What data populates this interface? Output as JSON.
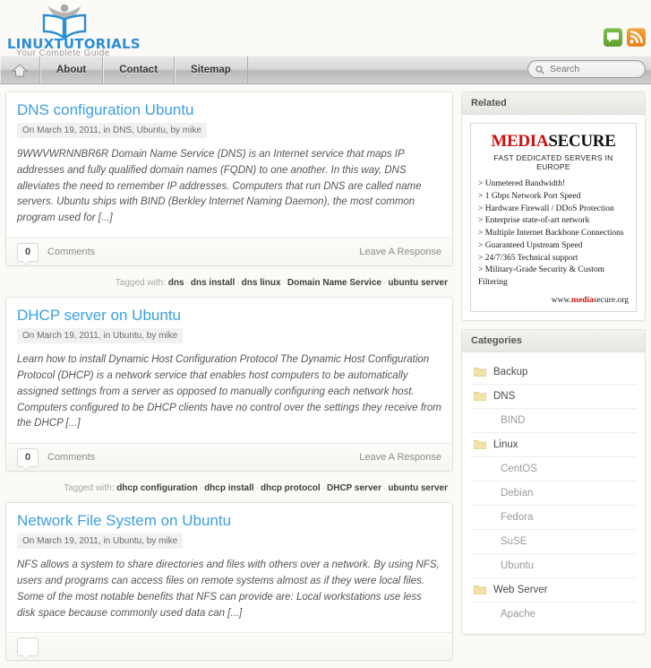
{
  "site": {
    "logo_word_1": "LINUX",
    "logo_word_2": "TUTORIALS",
    "logo_sub": "Your  Complete  Guide"
  },
  "social": [
    {
      "name": "comments-icon",
      "label": "Comments"
    },
    {
      "name": "rss-icon",
      "label": "RSS"
    }
  ],
  "nav": {
    "home_label": "Home",
    "items": [
      {
        "label": "About"
      },
      {
        "label": "Contact"
      },
      {
        "label": "Sitemap"
      }
    ]
  },
  "search": {
    "placeholder": "Search",
    "value": ""
  },
  "posts": [
    {
      "title": "DNS configuration Ubuntu",
      "meta": "On March 19, 2011, in DNS, Ubuntu, by mike",
      "excerpt": "9WWVWRNNBR6R Domain Name Service (DNS) is an Internet service that maps IP addresses and fully qualified domain names (FQDN) to one another. In this way, DNS alleviates the need to remember IP addresses. Computers that run DNS are called name servers. Ubuntu ships with BIND (Berkley Internet Naming Daemon), the most common program used for [...]",
      "comment_count": "0",
      "comments_label": "Comments",
      "respond_label": "Leave A Response",
      "tagged_label": "Tagged with:",
      "tags": [
        "dns",
        "dns install",
        "dns linux",
        "Domain Name Service",
        "ubuntu server"
      ]
    },
    {
      "title": "DHCP server on Ubuntu",
      "meta": "On March 19, 2011, in Ubuntu, by mike",
      "excerpt": "Learn how to install Dynamic Host Configuration Protocol The Dynamic Host Configuration Protocol (DHCP) is a network service that enables host computers to be automatically assigned settings from a server as opposed to manually configuring each network host. Computers configured to be DHCP clients have no control over the settings they receive from the DHCP [...]",
      "comment_count": "0",
      "comments_label": "Comments",
      "respond_label": "Leave A Response",
      "tagged_label": "Tagged with:",
      "tags": [
        "dhcp configuration",
        "dhcp install",
        "dhcp protocol",
        "DHCP server",
        "ubuntu server"
      ]
    },
    {
      "title": "Network File System on Ubuntu",
      "meta": "On March 19, 2011, in Ubuntu, by mike",
      "excerpt": "NFS allows a system to share directories and files with others over a network. By using NFS, users and programs can access files on remote systems almost as if they were local files. Some of the most notable benefits that NFS can provide are: Local workstations use less disk space because commonly used data can [...]",
      "comment_count": "",
      "comments_label": "",
      "respond_label": "",
      "tagged_label": "",
      "tags": []
    }
  ],
  "sidebar": {
    "related": {
      "title": "Related",
      "ad": {
        "brand_1": "MEDIA",
        "brand_2": "SECURE",
        "tagline": "FAST DEDICATED SERVERS IN EUROPE",
        "features": [
          "> Unmetered Bandwidth!",
          "> 1 Gbps Network Port Speed",
          "> Hardware Firewall / DDoS Protection",
          "> Enterprise state-of-art network",
          "> Multiple Internet Backbone Connections",
          "> Guaranteed Upstream Speed",
          "> 24/7/365 Technical support",
          "> Military-Grade Security & Custom Filtering"
        ],
        "url_pre": "www.",
        "url_mid": "media",
        "url_post": "secure.org"
      }
    },
    "categories": {
      "title": "Categories",
      "items": [
        {
          "label": "Backup",
          "sub": false
        },
        {
          "label": "DNS",
          "sub": false
        },
        {
          "label": "BIND",
          "sub": true
        },
        {
          "label": "Linux",
          "sub": false
        },
        {
          "label": "CentOS",
          "sub": true
        },
        {
          "label": "Debian",
          "sub": true
        },
        {
          "label": "Fedora",
          "sub": true
        },
        {
          "label": "SuSE",
          "sub": true
        },
        {
          "label": "Ubuntu",
          "sub": true
        },
        {
          "label": "Web Server",
          "sub": false
        },
        {
          "label": "Apache",
          "sub": true
        }
      ]
    }
  },
  "colors": {
    "link_blue": "#3b9fe0",
    "brand_blue": "#2a8ed6",
    "ad_red": "#cc1111",
    "page_bg": "#fbfaf7"
  }
}
